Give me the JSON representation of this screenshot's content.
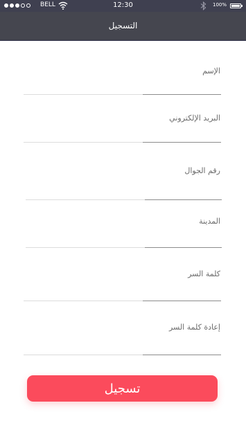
{
  "status_bar": {
    "carrier": "BELL",
    "time": "12:30",
    "battery": "100%",
    "signal_bars": 3,
    "icons": [
      "signal-dots-icon",
      "wifi-icon",
      "bluetooth-icon",
      "battery-icon"
    ]
  },
  "header": {
    "title": "التسجيل"
  },
  "form": {
    "fields": [
      {
        "label": "الإسم",
        "value": ""
      },
      {
        "label": "البريد الإلكتروني",
        "value": ""
      },
      {
        "label": "رقم الجوال",
        "value": ""
      },
      {
        "label": "المدينة",
        "value": ""
      },
      {
        "label": "كلمة السر",
        "value": ""
      },
      {
        "label": "إعادة كلمة السر",
        "value": ""
      }
    ],
    "submit_label": "تسجيل"
  },
  "colors": {
    "header_bg": "#45464f",
    "accent": "#fb4b5c",
    "underline_focus": "#8c8c8c",
    "underline": "#dcdcdc"
  }
}
